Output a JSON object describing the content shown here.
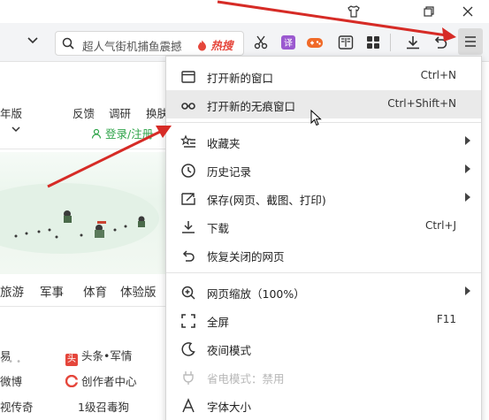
{
  "colors": {
    "annotation_arrow": "#d62b26",
    "hot_tag": "#e5463b",
    "menu_highlight": "#eaeaea",
    "login_link": "#2fa44a"
  },
  "titlebar": {
    "icons": [
      "shirt-icon",
      "restore-icon",
      "close-icon"
    ]
  },
  "toolbar": {
    "search_placeholder": "超人气街机捕鱼震撼",
    "hot_tag": "热搜",
    "icons": [
      "scissors-icon",
      "translate-icon",
      "game-icon",
      "reader-icon",
      "apps-icon",
      "download-icon",
      "undo-icon",
      "menu-icon"
    ]
  },
  "page": {
    "top_links": [
      "年版",
      "反馈",
      "调研",
      "换肤"
    ],
    "login": "登录/注册",
    "nav": [
      "旅游",
      "军事",
      "体育",
      "体验版"
    ],
    "list": [
      {
        "left": "易",
        "mid": "头条•军情"
      },
      {
        "left": "微博",
        "mid": "创作者中心"
      },
      {
        "left": "视传奇",
        "mid": "1级召毒狗"
      }
    ]
  },
  "menu": {
    "items": [
      {
        "icon": "new-window-icon",
        "label": "打开新的窗口",
        "shortcut": "Ctrl+N"
      },
      {
        "icon": "incognito-icon",
        "label": "打开新的无痕窗口",
        "shortcut": "Ctrl+Shift+N"
      },
      {
        "icon": "favorites-icon",
        "label": "收藏夹",
        "submenu": true
      },
      {
        "icon": "history-icon",
        "label": "历史记录",
        "submenu": true
      },
      {
        "icon": "save-icon",
        "label": "保存(网页、截图、打印)",
        "submenu": true
      },
      {
        "icon": "download-icon",
        "label": "下载",
        "shortcut": "Ctrl+J"
      },
      {
        "icon": "restore-tab-icon",
        "label": "恢复关闭的网页"
      },
      {
        "icon": "zoom-icon",
        "label": "网页缩放（100%）",
        "submenu": true
      },
      {
        "icon": "fullscreen-icon",
        "label": "全屏",
        "shortcut": "F11"
      },
      {
        "icon": "night-mode-icon",
        "label": "夜间模式"
      },
      {
        "icon": "power-save-icon",
        "label": "省电模式：禁用",
        "disabled": true
      },
      {
        "icon": "font-size-icon",
        "label": "字体大小"
      }
    ]
  }
}
